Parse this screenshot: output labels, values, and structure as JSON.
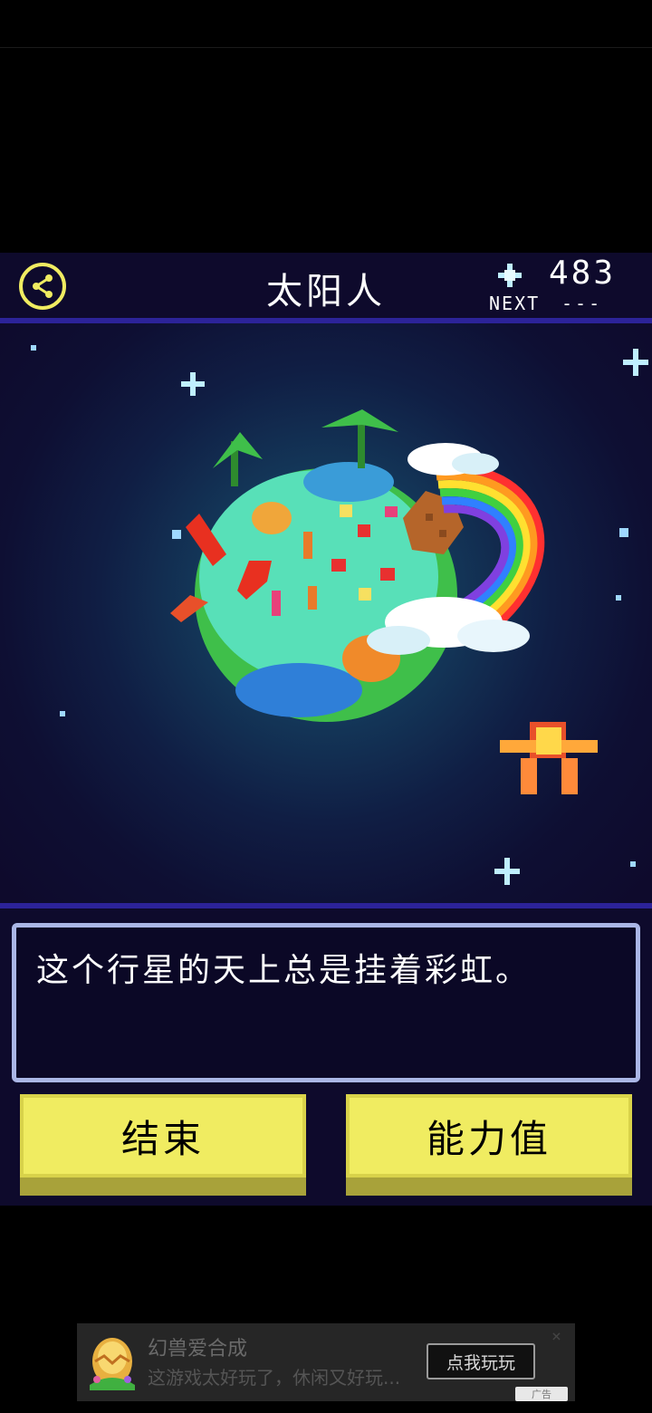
{
  "header": {
    "title": "太阳人",
    "score": "483",
    "next_label": "NEXT",
    "next_value": "---",
    "share_icon": "share-icon",
    "star_icon": "sparkle-icon"
  },
  "dialog": {
    "text": "这个行星的天上总是挂着彩虹。"
  },
  "buttons": {
    "end_label": "结束",
    "stats_label": "能力值"
  },
  "ad": {
    "title": "幻兽爱合成",
    "description": "这游戏太好玩了，休闲又好玩...",
    "cta_label": "点我玩玩",
    "close": "×",
    "badge": "广告"
  },
  "colors": {
    "accent_yellow": "#f0ec61",
    "divider_purple": "#2c2399",
    "background_navy": "#0e0a2c"
  }
}
